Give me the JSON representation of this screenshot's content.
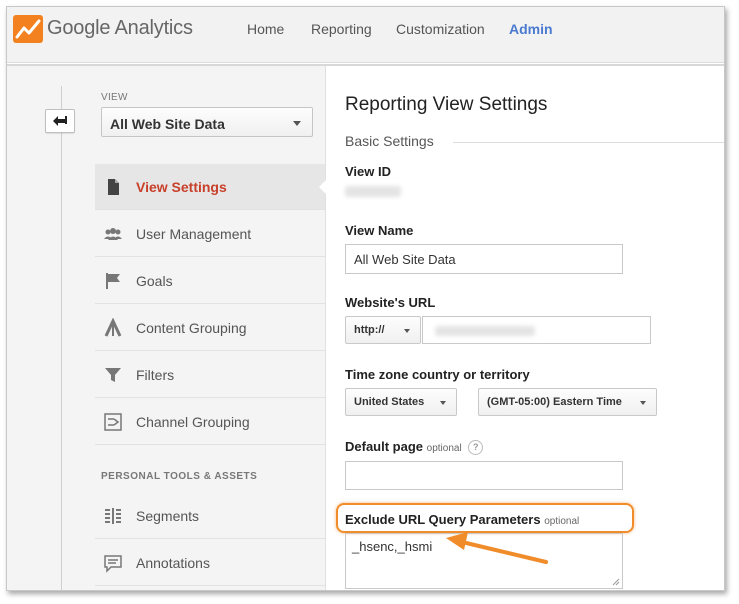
{
  "app": {
    "brand": "Google Analytics",
    "brand_colors": {
      "logo_orange": "#f4811f",
      "logo_dark": "#e25d10",
      "nav_active": "#4a7bd0",
      "menu_active": "#c8402a",
      "highlight": "#f08c2a"
    }
  },
  "header": {
    "nav": [
      {
        "label": "Home",
        "active": false
      },
      {
        "label": "Reporting",
        "active": false
      },
      {
        "label": "Customization",
        "active": false
      },
      {
        "label": "Admin",
        "active": true
      }
    ]
  },
  "sidebar": {
    "back_icon": "back-arrow-icon",
    "view_label": "VIEW",
    "view_selected": "All Web Site Data",
    "items": [
      {
        "label": "View Settings",
        "icon": "document-icon",
        "active": true
      },
      {
        "label": "User Management",
        "icon": "users-icon",
        "active": false
      },
      {
        "label": "Goals",
        "icon": "flag-icon",
        "active": false
      },
      {
        "label": "Content Grouping",
        "icon": "content-grouping-icon",
        "active": false
      },
      {
        "label": "Filters",
        "icon": "filter-icon",
        "active": false
      },
      {
        "label": "Channel Grouping",
        "icon": "channel-grouping-icon",
        "active": false
      }
    ],
    "personal_section_label": "PERSONAL TOOLS & ASSETS",
    "personal_items": [
      {
        "label": "Segments",
        "icon": "segments-icon"
      },
      {
        "label": "Annotations",
        "icon": "annotations-icon"
      }
    ]
  },
  "main": {
    "title": "Reporting View Settings",
    "section": "Basic Settings",
    "view_id": {
      "label": "View ID"
    },
    "view_name": {
      "label": "View Name",
      "value": "All Web Site Data"
    },
    "website_url": {
      "label": "Website's URL",
      "protocol": "http://"
    },
    "timezone": {
      "label": "Time zone country or territory",
      "country": "United States",
      "zone": "(GMT-05:00) Eastern Time"
    },
    "default_page": {
      "label": "Default page",
      "optional": "optional",
      "help": "?",
      "value": ""
    },
    "exclude_params": {
      "label": "Exclude URL Query Parameters",
      "optional": "optional",
      "value": "_hsenc,_hsmi"
    }
  }
}
